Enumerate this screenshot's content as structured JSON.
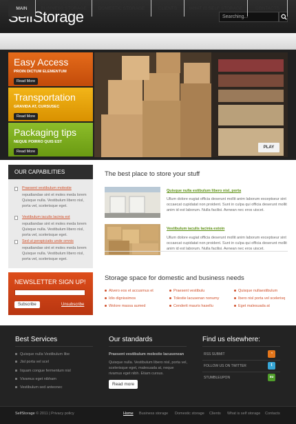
{
  "header": {
    "logo": "SelfStorage",
    "search_placeholder": "Searching..."
  },
  "nav": [
    "MAIN",
    "BUSINESS STORAGE",
    "DOMESTIC STORAGE",
    "CLIENTS",
    "WHAT IS SELF STORAGE",
    "CONTACTS"
  ],
  "hero": {
    "tiles": [
      {
        "title": "Easy Access",
        "subtitle": "PROIN DICTUM ELEMENTUM",
        "button": "Read More",
        "color": "#d85a10"
      },
      {
        "title": "Transportation",
        "subtitle": "GRAVIDA AT, CURSUSEC",
        "button": "Read More",
        "color": "#e8a400"
      },
      {
        "title": "Packaging tips",
        "subtitle": "NEQUE POIRRO QUIS EST",
        "button": "Read More",
        "color": "#79aa1d"
      }
    ],
    "play": "PLAY"
  },
  "capabilities": {
    "title": "OUR CAPABILITIES",
    "items": [
      {
        "link": "Praesent vestibulum molestie",
        "text": "repudiandae sint et moles meda lorem Quisque nulla. Vestibulum libero nisl, porta vel, scelerisque eget."
      },
      {
        "link": "Vestibulum iaculis lacinia est",
        "text": "repudiandae sint et moles meda lorem Quisque nulla. Vestibulum libero nisl, porta vel, scelerisque eget."
      },
      {
        "link": "Sed ut perspiciatis unde omnis",
        "text": "repudiandae sint et moles meda lorem Quisque nulla. Vestibulum libero nisl, porta vel, scelerisque eget."
      }
    ]
  },
  "newsletter": {
    "title": "NEWSLETTER SIGN UP!",
    "subscribe": "Subscribe",
    "unsubscribe": "Unsubscribe"
  },
  "main": {
    "heading": "The best place to store your stuff",
    "features": [
      {
        "link": "Quisque nulla estibulum libero nisl, porta",
        "text": "Ullum dolore eugiat officia deserunt mollit anim laborum exceptseur sint occaecat cupidatat non proident. Sunt in culpa qui officia deserunt mollit anim id est laborum. Nulla facilisi. Aenean nec eros uiscet."
      },
      {
        "link": "Vestibulum iaculis lacinia estoin",
        "text": "Ullum dolore eugiat officia deserunt mollit anim laborum exceptseur sint occaecat cupidatat non proident. Sunt in culpa qui officia deserunt mollit anim id est laborum. Nulla facilisi. Aenean nec eros uiscet."
      }
    ],
    "heading2": "Storage space for domestic and business needs",
    "links": [
      [
        "Atvero eos et accusmus et",
        "Idio dignissimos",
        "Wolore massa aumed"
      ],
      [
        "Praesent vestibulu",
        "Tolestie lacusenan nonumy",
        "Cenderit mauris hasellu"
      ],
      [
        "Quisque nullaestibulum",
        "Ibero nisl porta vel scelerisq",
        "Eget malesuada at"
      ]
    ]
  },
  "footer": {
    "best_services": {
      "title": "Best Services",
      "items": [
        "Quisque nulla Vestibulum libe",
        "Jisl porta vel scel",
        "Iiquam congue fermentum nisl",
        "Vivamus eget nibham",
        "Vestibulum sed anteonec"
      ]
    },
    "standards": {
      "title": "Our standards",
      "lead": "Praesent vestibulum molestie lacusenean",
      "text": "Quisque nulla. Vestibulum libero nisl, porta vel, scelerisque eget, malesuada at, neque rivamus eget nibh. Etiam cursus.",
      "button": "Read more"
    },
    "elsewhere": {
      "title": "Find us elsewhere:",
      "items": [
        {
          "label": "RSS SUBMIT",
          "icon": "rss-icon",
          "color": "#e4761b",
          "glyph": "◔"
        },
        {
          "label": "FOLLOW US ON TWITTER",
          "icon": "twitter-icon",
          "color": "#37a6d6",
          "glyph": "t"
        },
        {
          "label": "STUMBLEUPON",
          "icon": "stumbleupon-icon",
          "color": "#4f9d2a",
          "glyph": "su"
        }
      ]
    },
    "copyright_brand": "SelfStorage",
    "copyright_rest": " © 2011  |  Privacy policy",
    "nav": [
      "Home",
      "Business storage",
      "Domestic storage",
      "Clients",
      "What is self storage",
      "Contacts"
    ]
  }
}
